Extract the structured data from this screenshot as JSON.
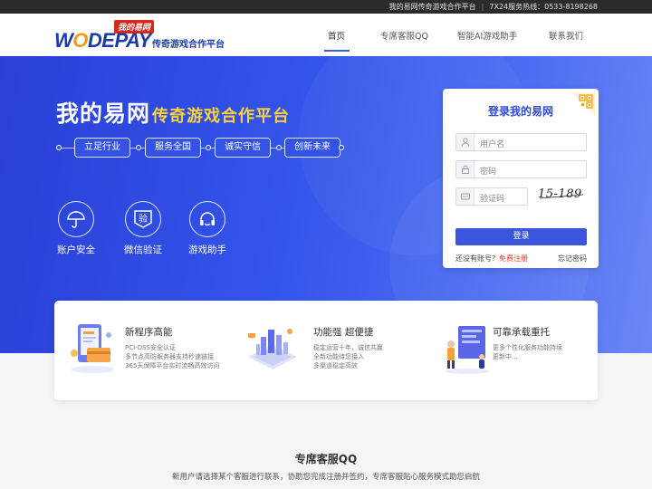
{
  "topbar": {
    "site_name": "我的易网传奇游戏合作平台",
    "hotline": "7X24服务热线：0533-8198268"
  },
  "header": {
    "logo_badge": "我的易网",
    "logo_text": "WODEPAY",
    "logo_slogan": "传奇游戏合作平台",
    "nav": [
      "首页",
      "专席客服QQ",
      "智能AI游戏助手",
      "联系我们"
    ],
    "active_nav": "首页"
  },
  "hero": {
    "title_main": "我的易网",
    "title_sub": "传奇游戏合作平台",
    "taglines": [
      "立足行业",
      "服务全国",
      "诚实守信",
      "创新未来"
    ],
    "features": [
      {
        "label": "账户安全",
        "icon": "umbrella-icon"
      },
      {
        "label": "微信验证",
        "icon": "verify-icon",
        "glyph": "验"
      },
      {
        "label": "游戏助手",
        "icon": "headset-icon"
      }
    ]
  },
  "login": {
    "title": "登录我的易网",
    "username_placeholder": "用户名",
    "password_placeholder": "密码",
    "captcha_placeholder": "验证码",
    "captcha_code": "15-189",
    "submit_label": "登录",
    "no_account_text": "还没有账号？",
    "register_label": "免费注册",
    "forgot_label": "忘记密码"
  },
  "strip": {
    "items": [
      {
        "title": "新程序高能",
        "lines": [
          "PCI-DSS安全认证",
          "多节点高防服务器支持秒速链接",
          "365天保障平台实时流畅高效访问"
        ]
      },
      {
        "title": "功能强 超便捷",
        "lines": [
          "稳定运营十年，诚信共赢",
          "全新功能待您接入",
          "多渠道稳定高效"
        ]
      },
      {
        "title": "可靠承载重托",
        "lines": [
          "更多个性化服务功能持续",
          "更新中..."
        ]
      }
    ]
  },
  "section": {
    "title": "专席客服QQ",
    "subtitle": "新用户请选择某个客服进行联系，协助您完成注册并签约，专席客服贴心服务模式助您启航"
  },
  "colors": {
    "brand_blue": "#3b56de",
    "accent_yellow": "#ffd23c",
    "register_red": "#e03a2f"
  }
}
